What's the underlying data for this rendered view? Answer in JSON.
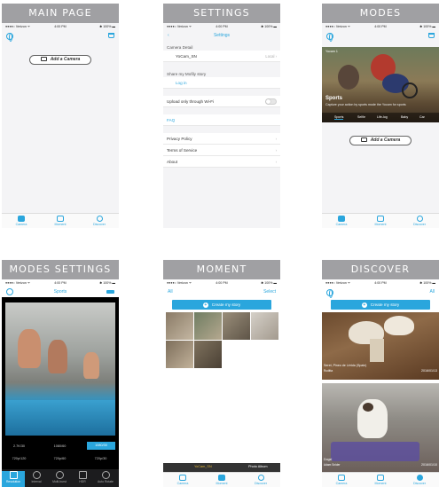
{
  "panels": {
    "main_page": {
      "title": "MAIN PAGE",
      "status": {
        "carrier": "●●●●○ Verizon ᯤ",
        "time": "4:00 PM",
        "battery": "✱ 100% ▬"
      },
      "add_camera_label": "Add a Camera",
      "tabs": [
        "Camera",
        "Moment",
        "Discover"
      ]
    },
    "settings": {
      "title": "SETTINGS",
      "status": {
        "carrier": "●●●●○ Verizon ᯤ",
        "time": "4:00 PM",
        "battery": "✱ 100% ▬"
      },
      "nav_title": "Settings",
      "back": "‹",
      "camera_detail_header": "Camera Detail",
      "camera_name": "YoCam_SN",
      "camera_status": "Local ›",
      "share_header": "Share my Mofily story",
      "login_label": "Log in",
      "upload_label": "Upload only through Wi-Fi",
      "faq_label": "FAQ",
      "privacy_label": "Privacy Policy",
      "terms_label": "Terms of Service",
      "about_label": "About",
      "chevron": "›"
    },
    "modes": {
      "title": "MODES",
      "status": {
        "carrier": "●●●●○ Verizon ᯤ",
        "time": "4:00 PM",
        "battery": "✱ 100% ▬"
      },
      "camera_tag": "Yocam 1",
      "mode_name": "Sports",
      "mode_description": "Capture your action by sports mode the Yocam for sports",
      "mode_tabs": [
        "Sports",
        "Selfie",
        "Life-log",
        "Baby",
        "Car"
      ],
      "add_camera_label": "Add a Camera",
      "tabs": [
        "Camera",
        "Moment",
        "Discover"
      ]
    },
    "modes_settings": {
      "title": "MODES SETTINGS",
      "status": {
        "carrier": "●●●●○ Verizon ᯤ",
        "time": "4:00 PM",
        "battery": "✱ 100% ▬"
      },
      "nav_title": "Sports",
      "options": [
        {
          "label": "2.7K/30",
          "selected": false
        },
        {
          "label": "1080/60",
          "selected": false
        },
        {
          "label": "1080/30",
          "selected": true
        },
        {
          "label": "720p/120",
          "selected": false
        },
        {
          "label": "720p/60",
          "selected": false
        },
        {
          "label": "720p/30",
          "selected": false
        }
      ],
      "tools": [
        "Resolution",
        "Interval",
        "Multi-burst",
        "HDR",
        "Auto Rotate"
      ]
    },
    "moment": {
      "title": "MOMENT",
      "status": {
        "carrier": "●●●●○ Verizon ᯤ",
        "time": "4:00 PM",
        "battery": "✱ 100% ▬"
      },
      "nav_left": "All",
      "nav_right": "Select",
      "create_story_label": "Create my story",
      "bottom_left": "YoCam_SN",
      "bottom_right": "Photo Album",
      "tabs": [
        "Camera",
        "Moment",
        "Discover"
      ]
    },
    "discover": {
      "title": "DISCOVER",
      "status": {
        "carrier": "●●●●○ Verizon ᯤ",
        "time": "4:00 PM",
        "battery": "✱ 100% ▬"
      },
      "nav_right": "All",
      "create_story_label": "Create my story",
      "post1_caption": "Seret, Pineo de Lérida (Spain)",
      "post1_author": "Ruditta",
      "post1_date": "2016/01/13",
      "post2_caption": "Dogs!",
      "post2_author": "Adam Snider",
      "post2_date": "2016/01/10",
      "tabs": [
        "Camera",
        "Moment",
        "Discover"
      ]
    }
  },
  "colors": {
    "accent": "#2aa6dd",
    "banner": "#a0a0a3",
    "background": "#f4f4f6"
  }
}
